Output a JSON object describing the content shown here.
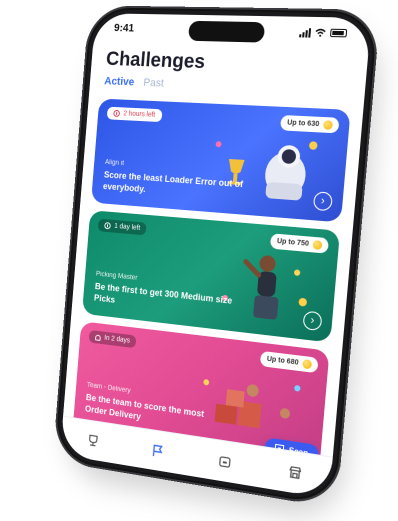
{
  "status_bar": {
    "time": "9:41"
  },
  "header": {
    "title": "Challenges"
  },
  "tabs": [
    {
      "label": "Active",
      "active": true
    },
    {
      "label": "Past",
      "active": false
    }
  ],
  "cards": [
    {
      "time_left": "2 hours left",
      "reward": "Up to 630",
      "category": "Align it",
      "description": "Score the least Loader Error out of everybody.",
      "color": "#3a62f2"
    },
    {
      "time_left": "1 day left",
      "reward": "Up to 750",
      "category": "Picking Master",
      "description": "Be the first to get 300 Medium size Picks",
      "color": "#178f70"
    },
    {
      "time_left": "In 2 days",
      "reward": "Up to 680",
      "category": "Team - Delivery",
      "description": "Be the team to score the most Order Delivery",
      "color": "#e24f96"
    }
  ],
  "scan_button": {
    "label": "Scan"
  },
  "bottom_nav": [
    {
      "icon": "trophy-icon"
    },
    {
      "icon": "flag-icon",
      "active": true
    },
    {
      "icon": "wallet-icon"
    },
    {
      "icon": "store-icon"
    }
  ]
}
